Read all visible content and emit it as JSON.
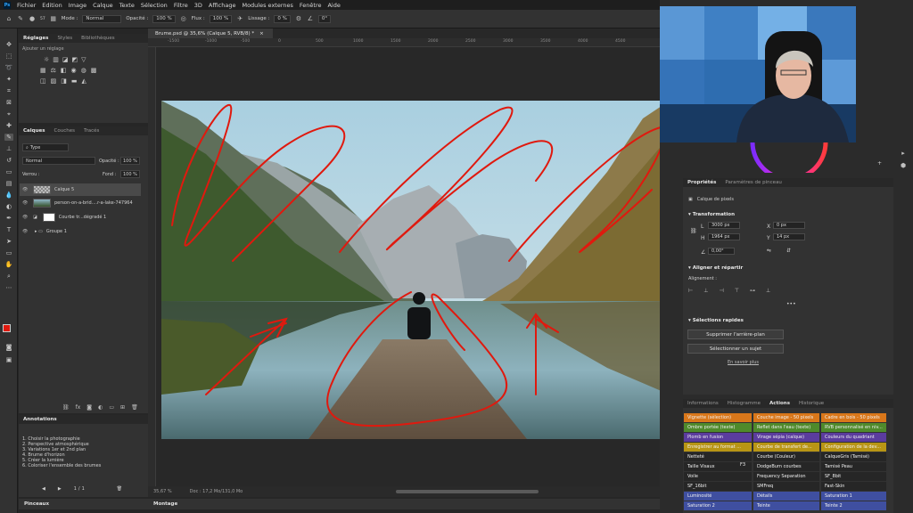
{
  "menu": [
    "Fichier",
    "Edition",
    "Image",
    "Calque",
    "Texte",
    "Sélection",
    "Filtre",
    "3D",
    "Affichage",
    "Modules externes",
    "Fenêtre",
    "Aide"
  ],
  "options": {
    "brush_size": "57",
    "mode_label": "Mode :",
    "mode_value": "Normal",
    "opacity_label": "Opacité :",
    "opacity_value": "100 %",
    "flow_label": "Flux :",
    "flow_value": "100 %",
    "smoothing_label": "Lissage :",
    "smoothing_value": "0 %",
    "angle_value": "0°"
  },
  "adjustments": {
    "tabs": [
      "Réglages",
      "Styles",
      "Bibliothèques"
    ],
    "hint": "Ajouter un réglage"
  },
  "layers_panel": {
    "tabs": [
      "Calques",
      "Couches",
      "Tracés"
    ],
    "filter_label": "Type",
    "blend_mode": "Normal",
    "opacity_label": "Opacité :",
    "opacity_value": "100 %",
    "lock_label": "Verrou :",
    "fill_label": "Fond :",
    "fill_value": "100 %",
    "layers": [
      {
        "name": "Calque 5"
      },
      {
        "name": "person-on-a-brid....r-a-lake-747964"
      },
      {
        "name": "Courbe tr...dégradé 1"
      },
      {
        "name": "Groupe 1"
      }
    ]
  },
  "annotations": {
    "title": "Annotations",
    "lines": [
      "1. Choisir la photographie",
      "2. Perspective atmosphérique",
      "3. Variations 1er et 2nd plan",
      "4. Brume d'horizon",
      "5. Créer la lumière",
      "6. Coloriser l'ensemble des brumes"
    ],
    "pager": "1",
    "pager_sep": "/",
    "pager_total": "1"
  },
  "bottom_tabs": [
    "Pinceaux",
    "Montage"
  ],
  "document": {
    "tab_title": "Brume.psd @ 35,6% (Calque 5, RVB/8) *",
    "zoom": "35,67 %",
    "doc_info": "Doc : 17,2 Mo/131,0 Mo",
    "ruler_marks": [
      "-1500",
      "-1000",
      "-500",
      "0",
      "500",
      "1000",
      "1500",
      "2000",
      "2500",
      "3000",
      "3500",
      "4000",
      "4500"
    ]
  },
  "properties": {
    "tabs": [
      "Propriétés",
      "Paramètres de pinceau"
    ],
    "layer_kind": "Calque de pixels",
    "transform_title": "Transformation",
    "w_label": "L",
    "w_value": "3000 px",
    "h_label": "H",
    "h_value": "1964 px",
    "x_label": "X",
    "x_value": "0 px",
    "y_label": "Y",
    "y_value": "14 px",
    "angle": "0,00°",
    "align_title": "Aligner et répartir",
    "align_label": "Alignement :",
    "quick_title": "Sélections rapides",
    "remove_bg": "Supprimer l'arrière-plan",
    "select_subject": "Sélectionner un sujet",
    "learn_more": "En savoir plus"
  },
  "actions_panel": {
    "tabs": [
      "Informations",
      "Histogramme",
      "Actions",
      "Historique"
    ],
    "rows": [
      [
        "Vignette (sélection)",
        "Couche image - 50 pixels",
        "Cadre en bois - 50 pixels"
      ],
      [
        "Ombre portée (texte)",
        "Reflet dans l'eau (texte)",
        "RVB personnalisé en niv..."
      ],
      [
        "Plomb en fusion",
        "Virage sépia (calque)",
        "Couleurs du quadriant"
      ],
      [
        "Enregistrer au format ...",
        "Courbe de transfert de...",
        "Configuration de la dev..."
      ],
      [
        "Netteté",
        "Courbe (Couleur)",
        "CalqueGris (Tamisé)"
      ],
      [
        "Taille Visaux",
        "DodgeBurn courbes",
        "Tamisé Peau"
      ],
      [
        "Voile",
        "Frequency Separation",
        "SF_8bit"
      ],
      [
        "SF_16bit",
        "SMFreq",
        "Fast-Skin"
      ],
      [
        "Luminosité",
        "Détails",
        "Saturation 1"
      ],
      [
        "Saturation 2",
        "Teinte",
        "Teinte 2"
      ]
    ],
    "row5_shortcut": "F3",
    "colors": {
      "orange": "#d9771a",
      "green": "#4f8a2b",
      "purple": "#5b3c9e",
      "yellow": "#b89515",
      "dark": "#262626",
      "blue": "#3f4fa0"
    }
  },
  "colors": {
    "foreground": "#e0190e",
    "background": "#111111",
    "stroke": "#e0190e"
  }
}
